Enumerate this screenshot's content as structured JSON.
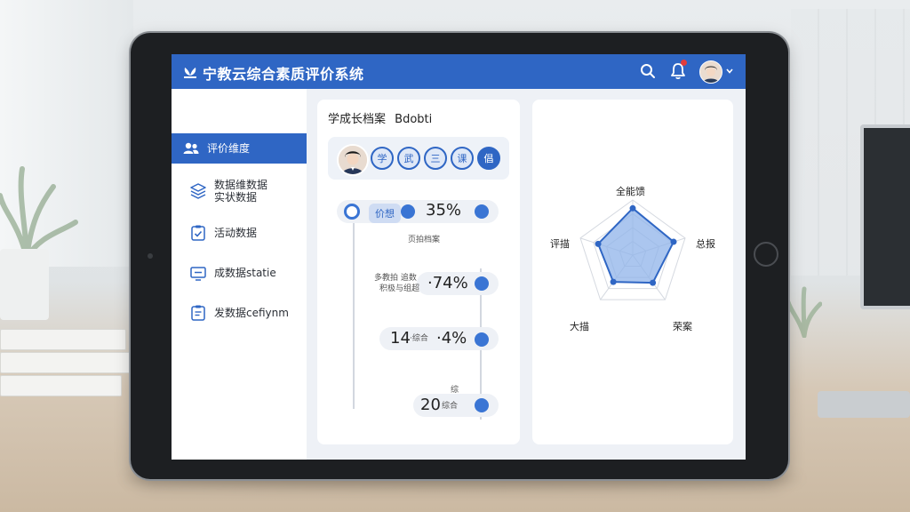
{
  "app": {
    "title": "宁教云综合素质评价系统"
  },
  "sidebar": {
    "items": [
      {
        "label": "评价维度",
        "icon": "users-icon",
        "active": true
      },
      {
        "label": "数据维数据\n实状数据",
        "icon": "layers-icon",
        "active": false
      },
      {
        "label": "活动数据",
        "icon": "checklist-icon",
        "active": false
      },
      {
        "label": "成数据statie",
        "icon": "monitor-icon",
        "active": false
      },
      {
        "label": "发数据cefiynm",
        "icon": "clipboard-icon",
        "active": false
      }
    ]
  },
  "profile": {
    "title": "学成长档案",
    "title_suffix": "Bdobti",
    "chips": [
      "学",
      "武",
      "三",
      "课",
      "倡"
    ]
  },
  "timeline": {
    "first_tag": "价想",
    "first_value": "35%",
    "caption_1": "页拍档案",
    "row2_small_1": "多教拍 追数",
    "row2_small_2": "积极与组超",
    "row2_value": "·74%",
    "row3_left": "14",
    "row3_small": "·综合",
    "row3_value": "·4%",
    "row4_small": "综",
    "row4_value": "20",
    "row4_suffix": "综合"
  },
  "radar": {
    "labels": [
      "全能馈",
      "总报",
      "荣案",
      "大描",
      "评描"
    ],
    "values": [
      0.85,
      0.78,
      0.62,
      0.6,
      0.66
    ],
    "colors": {
      "fill": "#8fb3ea",
      "stroke": "#2f66c4",
      "grid": "#d5d9e0"
    }
  },
  "colors": {
    "accent": "#2f66c4",
    "notification": "#e23c3c"
  },
  "icons": {
    "logo": "leaf-logo-icon",
    "search": "search-icon",
    "bell": "bell-icon",
    "avatar": "avatar",
    "chevron": "chevron-down-icon"
  }
}
